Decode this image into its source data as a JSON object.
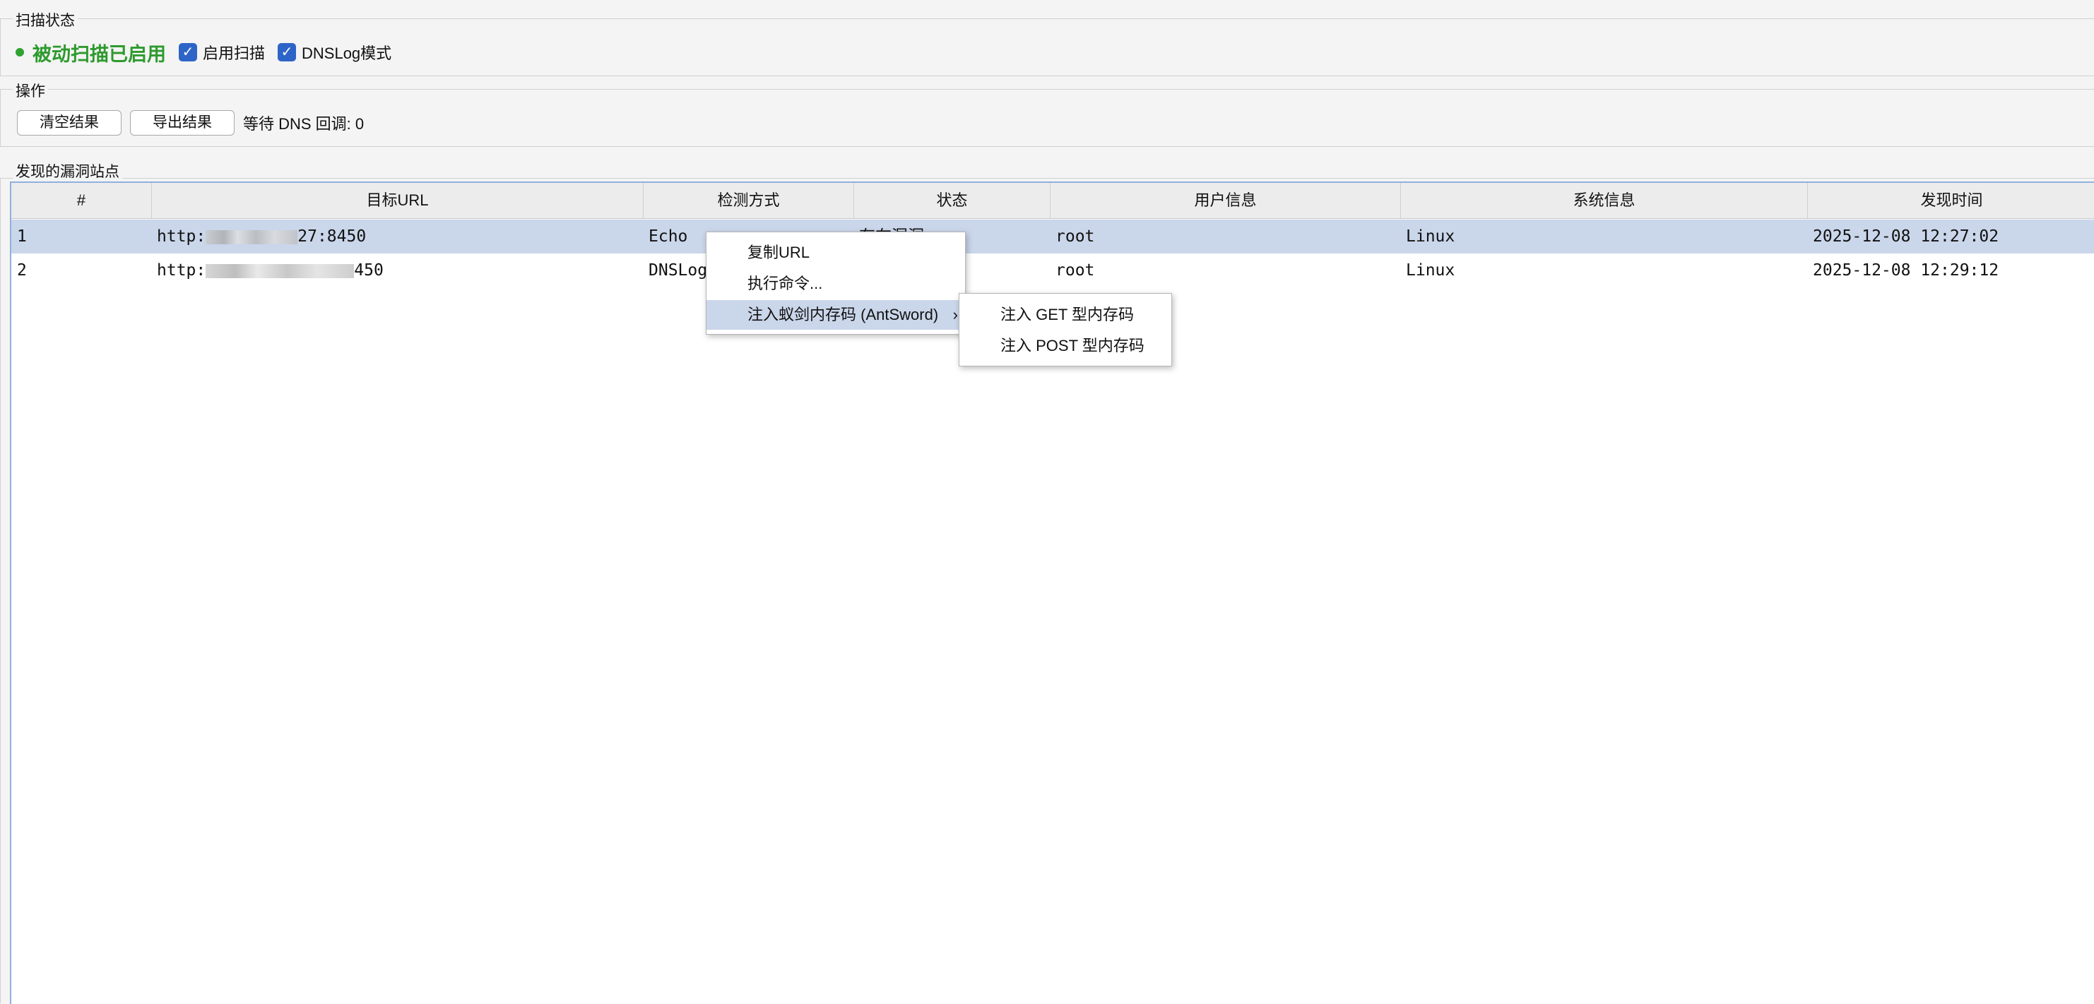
{
  "scan_status": {
    "group_title": "扫描状态",
    "status_text": "被动扫描已启用",
    "status_color": "#2e9a2e",
    "enable_scan_label": "启用扫描",
    "enable_scan_checked": true,
    "dnslog_label": "DNSLog模式",
    "dnslog_checked": true
  },
  "operations": {
    "group_title": "操作",
    "clear_label": "清空结果",
    "export_label": "导出结果",
    "dns_waiting": "等待 DNS 回调: 0"
  },
  "results": {
    "group_title": "发现的漏洞站点",
    "columns": [
      "#",
      "目标URL",
      "检测方式",
      "状态",
      "用户信息",
      "系统信息",
      "发现时间"
    ],
    "rows": [
      {
        "num": "1",
        "url_prefix": "http:",
        "url_suffix": "27:8450",
        "method": "Echo",
        "status": "存在漏洞",
        "user": "root",
        "system": "Linux",
        "time": "2025-12-08 12:27:02",
        "selected": true
      },
      {
        "num": "2",
        "url_prefix": "http:",
        "url_suffix": "450",
        "method": "DNSLog",
        "status": "",
        "user": "root",
        "system": "Linux",
        "time": "2025-12-08 12:29:12",
        "selected": false
      }
    ]
  },
  "context_menu": {
    "items": [
      "复制URL",
      "执行命令...",
      "注入蚁剑内存码 (AntSword)"
    ],
    "submenu_arrow": "›",
    "submenu": [
      "注入 GET 型内存码",
      "注入 POST 型内存码"
    ]
  },
  "icons": {
    "checkbox": "checkmark-icon",
    "status_dot": "status-dot-icon",
    "submenu": "chevron-right-icon"
  }
}
